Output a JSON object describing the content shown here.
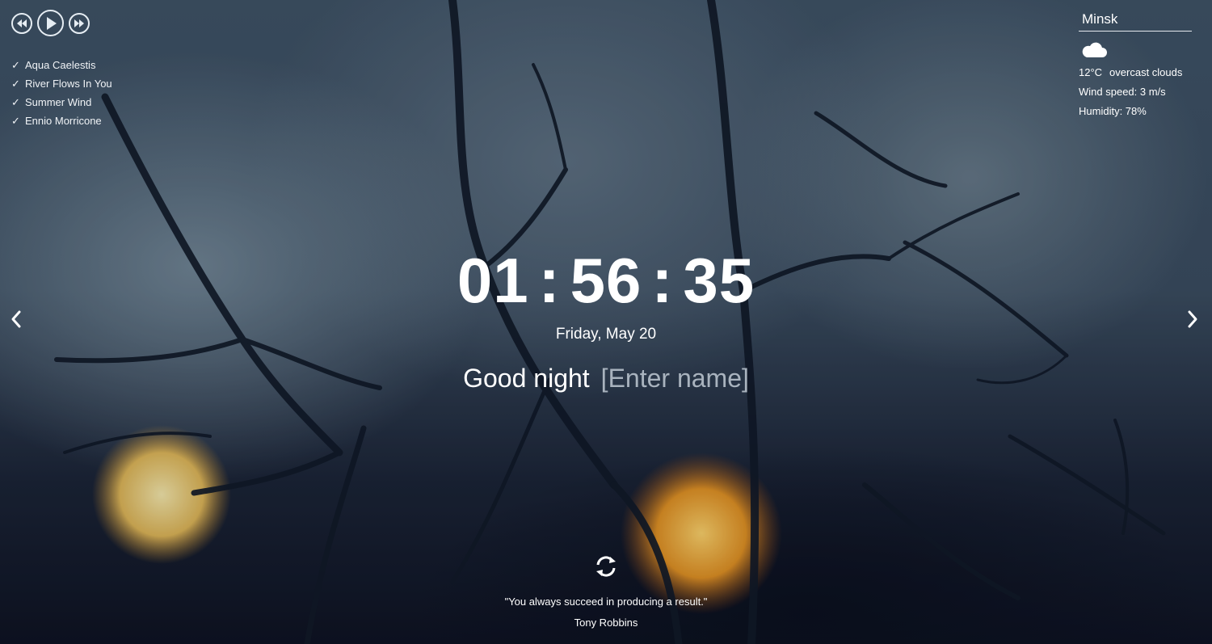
{
  "player": {
    "icons": [
      "rewind-icon",
      "play-icon",
      "fast-forward-icon"
    ],
    "tracks": [
      {
        "title": "Aqua Caelestis"
      },
      {
        "title": "River Flows In You"
      },
      {
        "title": "Summer Wind"
      },
      {
        "title": "Ennio Morricone"
      }
    ]
  },
  "weather": {
    "city": "Minsk",
    "icon": "cloud-icon",
    "temperature": "12°C",
    "description": "overcast clouds",
    "wind": "Wind speed: 3 m/s",
    "humidity": "Humidity: 78%"
  },
  "clock": {
    "hours": "01",
    "minutes": "56",
    "seconds": "35",
    "separator": ":"
  },
  "date": "Friday, May 20",
  "greeting": {
    "text": "Good night",
    "name_placeholder": "[Enter name]"
  },
  "navigation": {
    "prev_icon": "chevron-left-icon",
    "next_icon": "chevron-right-icon"
  },
  "quote": {
    "refresh_icon": "refresh-icon",
    "text": "\"You always succeed in producing a result.\"",
    "author": "Tony Robbins"
  },
  "colors": {
    "text": "#ffffff",
    "placeholder": "#a9b3be",
    "sunlight": "#f5a623"
  }
}
